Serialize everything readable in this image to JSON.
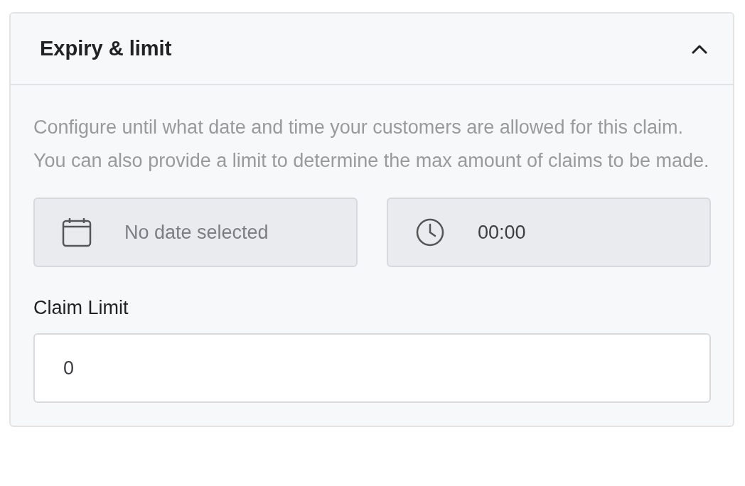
{
  "section": {
    "title": "Expiry & limit",
    "expanded": true,
    "description": "Configure until what date and time your customers are allowed for this claim. You can also provide a limit to determine the max amount of claims to be made.",
    "pickers": [
      {
        "kind": "date",
        "value": "No date selected",
        "muted": true
      },
      {
        "kind": "time",
        "value": "00:00",
        "muted": false
      }
    ],
    "limit": {
      "label": "Claim Limit",
      "value": "0"
    }
  }
}
